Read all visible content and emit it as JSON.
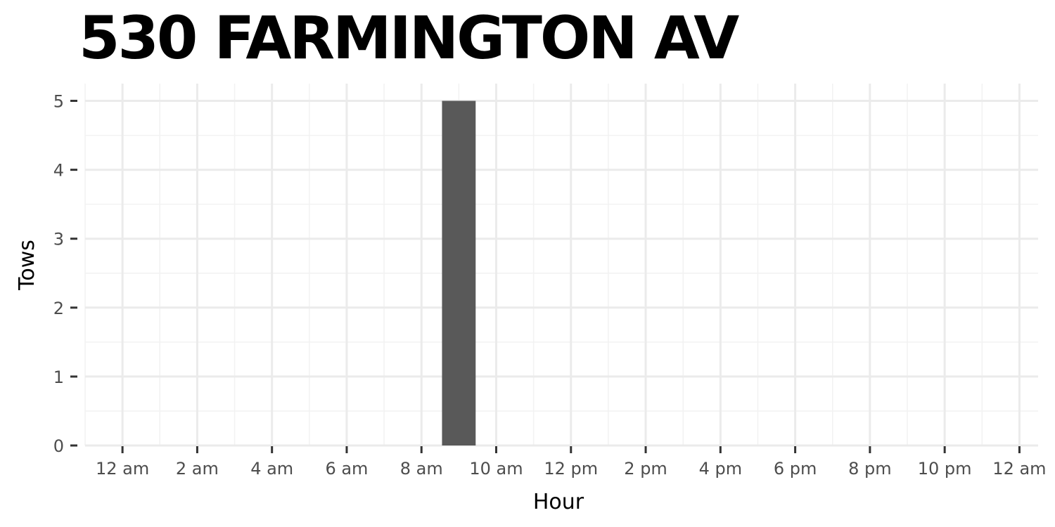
{
  "chart_data": {
    "type": "bar",
    "title": "530 FARMINGTON AV",
    "xlabel": "Hour",
    "ylabel": "Tows",
    "x_tick_hours": [
      0,
      2,
      4,
      6,
      8,
      10,
      12,
      14,
      16,
      18,
      20,
      22,
      24
    ],
    "x_tick_labels": [
      "12 am",
      "2 am",
      "4 am",
      "6 am",
      "8 am",
      "10 am",
      "12 pm",
      "2 pm",
      "4 pm",
      "6 pm",
      "8 pm",
      "10 pm",
      "12 am"
    ],
    "xlim": [
      -1,
      24.5
    ],
    "y_ticks": [
      0,
      1,
      2,
      3,
      4,
      5
    ],
    "ylim": [
      0,
      5.25
    ],
    "bars": [
      {
        "hour": 9,
        "value": 5
      }
    ],
    "bar_width_hours": 0.9,
    "grid": true,
    "colors": {
      "bar": "#595959",
      "grid_major": "#ebebeb",
      "grid_minor": "#f2f2f2",
      "tick": "#333333",
      "tick_text": "#4d4d4d"
    }
  }
}
